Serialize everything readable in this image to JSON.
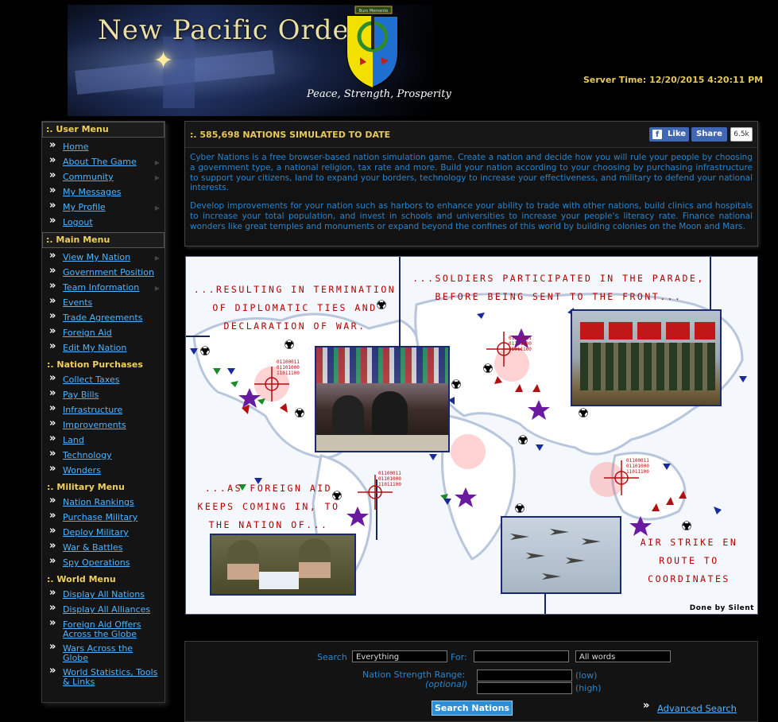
{
  "header": {
    "banner_title": "New Pacific Order",
    "motto": "Peace, Strength, Prosperity",
    "crest_ribbon": "Buro Memento",
    "server_time": "Server Time: 12/20/2015 4:20:11 PM"
  },
  "sidebar": {
    "user_menu": {
      "title": ":. User Menu",
      "items": [
        "Home",
        "About The Game",
        "Community",
        "My Messages",
        "My Profile",
        "Logout"
      ]
    },
    "main_menu": {
      "title": ":. Main Menu",
      "items": [
        "View My Nation",
        "Government Position",
        "Team Information",
        "Events",
        "Trade Agreements",
        "Foreign Aid",
        "Edit My Nation"
      ]
    },
    "nation_purchases": {
      "title": ":. Nation Purchases",
      "items": [
        "Collect Taxes",
        "Pay Bills",
        "Infrastructure",
        "Improvements",
        "Land",
        "Technology",
        "Wonders"
      ]
    },
    "military_menu": {
      "title": ":. Military Menu",
      "items": [
        "Nation Rankings",
        "Purchase Military",
        "Deploy Military",
        "War & Battles",
        "Spy Operations"
      ]
    },
    "world_menu": {
      "title": ":. World Menu",
      "items": [
        "Display All Nations",
        "Display All Alliances",
        "Foreign Aid Offers Across the Globe",
        "Wars Across the Globe",
        "World Statistics, Tools & Links"
      ]
    }
  },
  "main": {
    "title": ":. 585,698 NATIONS SIMULATED TO DATE",
    "fb_like": "Like",
    "fb_share": "Share",
    "fb_count": "6.5k",
    "paragraph1": "Cyber Nations is a free browser-based nation simulation game. Create a nation and decide how you will rule your people by choosing a government type, a national religion, tax rate and more. Build your nation according to your choosing by purchasing infrastructure to support your citizens, land to expand your borders, technology to increase your effectiveness, and military to defend your national interests.",
    "paragraph2": "Develop improvements for your nation such as harbors to enhance your ability to trade with other nations, build clinics and hospitals to increase your total population, and invest in schools and universities to increase your people's literacy rate. Finance national wonders like great temples and monuments or expand beyond the confines of this world by building colonies on the Moon and Mars."
  },
  "map": {
    "caption1": [
      "...RESULTING IN TERMINATION",
      "OF DIPLOMATIC TIES AND",
      "DECLARATION OF WAR."
    ],
    "caption2": [
      "...SOLDIERS PARTICIPATED IN THE PARADE,",
      "BEFORE BEING SENT TO THE FRONT..."
    ],
    "caption3": [
      "...AS FOREIGN AID",
      "KEEPS COMING IN, TO",
      "THE NATION OF..."
    ],
    "caption4": [
      "AIR STRIKE EN",
      "ROUTE TO",
      "COORDINATES"
    ],
    "credit": "Done by Silent",
    "binary": "01100011\n01101000\n11011100"
  },
  "search": {
    "search_label": "Search",
    "scope_value": "Everything",
    "for_label": "For:",
    "query_value": "",
    "match_value": "All words",
    "range_label": "Nation Strength Range:",
    "optional_label": "(optional)",
    "low_label": "(low)",
    "high_label": "(high)",
    "button_label": "Search Nations",
    "advanced_label": "Advanced Search"
  }
}
